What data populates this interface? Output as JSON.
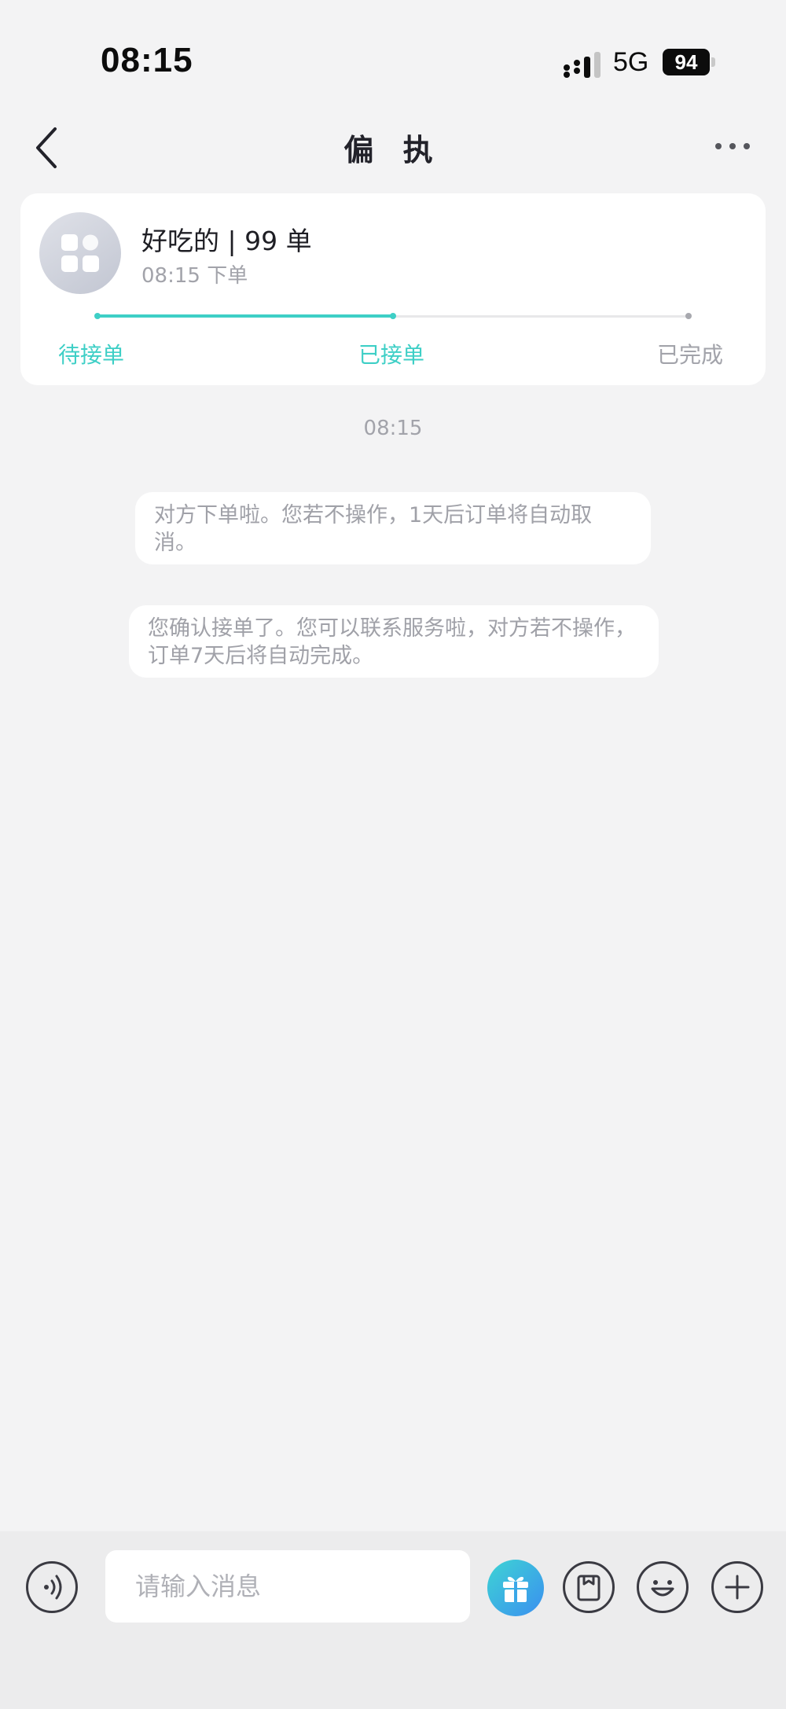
{
  "status_bar": {
    "time": "08:15",
    "network": "5G",
    "battery": "94"
  },
  "nav": {
    "title": "偏 执"
  },
  "order_card": {
    "title": "好吃的 | 99 单",
    "time": "08:15 下单",
    "progress": 0.5,
    "steps": [
      {
        "label": "待接单",
        "state": "done"
      },
      {
        "label": "已接单",
        "state": "current"
      },
      {
        "label": "已完成",
        "state": "pending"
      }
    ],
    "accent_color": "#3ecfc6"
  },
  "chat": {
    "timestamp": "08:15",
    "messages": [
      {
        "text": "对方下单啦。您若不操作，1天后订单将自动取消。"
      },
      {
        "text": "您确认接单了。您可以联系服务啦，对方若不操作，订单7天后将自动完成。"
      }
    ]
  },
  "input_bar": {
    "placeholder": "请输入消息",
    "icons": [
      "voice-icon",
      "gift-icon",
      "order-icon",
      "emoji-icon",
      "plus-icon"
    ]
  }
}
